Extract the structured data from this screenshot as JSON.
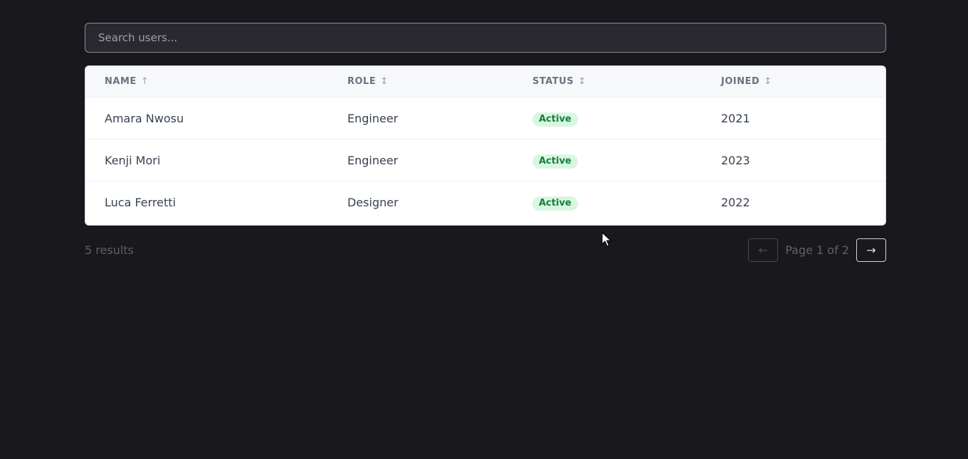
{
  "search": {
    "placeholder": "Search users..."
  },
  "table": {
    "columns": [
      {
        "label": "NAME",
        "sort_indicator": "↑"
      },
      {
        "label": "ROLE",
        "sort_indicator": "↕"
      },
      {
        "label": "STATUS",
        "sort_indicator": "↕"
      },
      {
        "label": "JOINED",
        "sort_indicator": "↕"
      }
    ],
    "rows": [
      {
        "name": "Amara Nwosu",
        "role": "Engineer",
        "status": "Active",
        "joined": "2021"
      },
      {
        "name": "Kenji Mori",
        "role": "Engineer",
        "status": "Active",
        "joined": "2023"
      },
      {
        "name": "Luca Ferretti",
        "role": "Designer",
        "status": "Active",
        "joined": "2022"
      }
    ]
  },
  "footer": {
    "results": "5 results",
    "page_info": "Page 1 of 2",
    "prev_label": "←",
    "next_label": "→"
  },
  "colors": {
    "background": "#18181d",
    "status_active_bg": "#d9f6e1",
    "status_active_text": "#15803d"
  },
  "icons": {
    "cursor": "arrow-cursor-icon"
  }
}
